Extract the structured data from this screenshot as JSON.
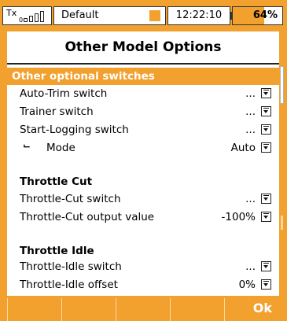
{
  "status": {
    "tx_label": "Tx",
    "rx_label": "0",
    "model_name": "Default",
    "time": "12:22:10",
    "battery": "64%",
    "battery_level": 0.64
  },
  "title": "Other Model Options",
  "sections": {
    "optional": {
      "header": "Other optional switches",
      "rows": [
        {
          "label": "Auto-Trim switch",
          "value": "..."
        },
        {
          "label": "Trainer switch",
          "value": "..."
        },
        {
          "label": "Start-Logging switch",
          "value": "..."
        },
        {
          "label": "Mode",
          "value": "Auto"
        }
      ]
    },
    "cut": {
      "header": "Throttle Cut",
      "rows": [
        {
          "label": "Throttle-Cut switch",
          "value": "..."
        },
        {
          "label": "Throttle-Cut output value",
          "value": "-100%"
        }
      ]
    },
    "idle": {
      "header": "Throttle Idle",
      "rows": [
        {
          "label": "Throttle-Idle switch",
          "value": "..."
        },
        {
          "label": "Throttle-Idle offset",
          "value": "0%"
        }
      ]
    }
  },
  "softkeys": [
    "",
    "",
    "",
    "",
    "Ok"
  ]
}
